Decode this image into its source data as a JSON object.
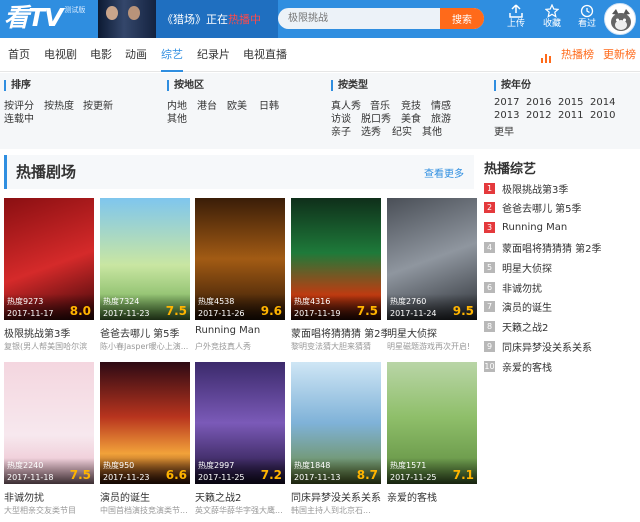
{
  "header": {
    "logo_text": "看TV",
    "logo_sub": "测试版",
    "promo": {
      "pre": "《猎场》正在",
      "hl": "热播中"
    },
    "search": {
      "placeholder": "极限挑战",
      "button": "搜索"
    },
    "actions": [
      {
        "label": "上传",
        "icon": "upload-icon"
      },
      {
        "label": "收藏",
        "icon": "star-icon"
      },
      {
        "label": "看过",
        "icon": "history-icon"
      }
    ]
  },
  "nav": {
    "items": [
      "首页",
      "电视剧",
      "电影",
      "动画",
      "综艺",
      "纪录片",
      "电视直播"
    ],
    "active": 4,
    "right": [
      "热播榜",
      "更新榜"
    ]
  },
  "filters": [
    {
      "title": "排序",
      "options": [
        "按评分",
        "按热度",
        "按更新"
      ],
      "extra": "连载中"
    },
    {
      "title": "按地区",
      "options": [
        "内地",
        "港台",
        "欧美",
        "日韩",
        "其他"
      ]
    },
    {
      "title": "按类型",
      "options": [
        "真人秀",
        "音乐",
        "竞技",
        "情感",
        "访谈",
        "脱口秀",
        "美食",
        "旅游",
        "亲子",
        "选秀",
        "纪实",
        "其他"
      ]
    },
    {
      "title": "按年份",
      "options": [
        "2017",
        "2016",
        "2015",
        "2014",
        "2013",
        "2012",
        "2011",
        "2010",
        "更早"
      ]
    }
  ],
  "section": {
    "title": "热播剧场",
    "more": "查看更多"
  },
  "cards": [
    {
      "heat": "热度9273",
      "date": "2017-11-17",
      "score": "8.0",
      "title": "极限挑战第3季",
      "desc": "复银(男人帮美国哈尔滨"
    },
    {
      "heat": "热度7324",
      "date": "2017-11-23",
      "score": "7.5",
      "title": "爸爸去哪儿 第5季",
      "desc": "陈小春Jasper暖心上演..."
    },
    {
      "heat": "热度4538",
      "date": "2017-11-26",
      "score": "9.6",
      "title": "Running Man",
      "desc": "户外竞技真人秀"
    },
    {
      "heat": "热度4316",
      "date": "2017-11-19",
      "score": "7.5",
      "title": "蒙面唱将猜猜猜 第2季",
      "desc": "黎明变法猜大胆来猜猜"
    },
    {
      "heat": "热度2760",
      "date": "2017-11-24",
      "score": "9.5",
      "title": "明星大侦探",
      "desc": "明星磁题游戏再次开启!"
    },
    {
      "heat": "热度2240",
      "date": "2017-11-18",
      "score": "7.5",
      "title": "非诚勿扰",
      "desc": "大型相亲交友类节目"
    },
    {
      "heat": "热度950",
      "date": "2017-11-23",
      "score": "6.6",
      "title": "演员的诞生",
      "desc": "中国首档演技竞演类节..."
    },
    {
      "heat": "热度2997",
      "date": "2017-11-25",
      "score": "7.2",
      "title": "天籁之战2",
      "desc": "英文薛华薛华字强大鹰..."
    },
    {
      "heat": "热度1848",
      "date": "2017-11-13",
      "score": "8.7",
      "title": "同床异梦没关系关系",
      "desc": "韩国主持人到北京石..."
    },
    {
      "heat": "热度1571",
      "date": "2017-11-25",
      "score": "7.1",
      "title": "亲爱的客栈",
      "desc": ""
    }
  ],
  "rank": {
    "title": "热播综艺",
    "items": [
      "极限挑战第3季",
      "爸爸去哪儿 第5季",
      "Running Man",
      "蒙面唱将猜猜猜 第2季",
      "明星大侦探",
      "非诚勿扰",
      "演员的诞生",
      "天籁之战2",
      "同床异梦没关系关系",
      "亲爱的客栈"
    ]
  },
  "colors": {
    "brand": "#2f8ee0",
    "accent": "#ff6a1a",
    "rank_top": "#e4393c",
    "rank_other": "#b8b8b8",
    "score": "#ffb400"
  }
}
